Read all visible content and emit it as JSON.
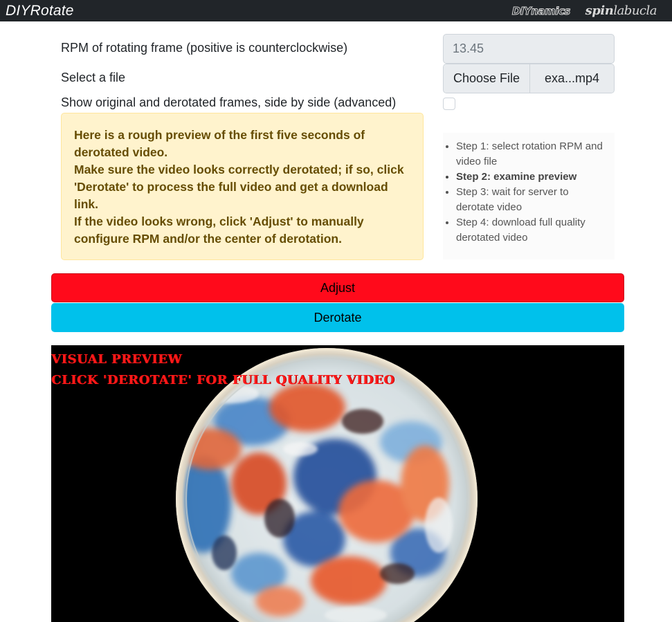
{
  "navbar": {
    "brand": "DIYRotate",
    "logo_left": "DIYnamics",
    "logo_right_spin": "spin",
    "logo_right_lab": "lab",
    "logo_right_ucla": "ucla"
  },
  "form": {
    "rpm_label": "RPM of rotating frame (positive is counterclockwise)",
    "rpm_value": "13.45",
    "file_label": "Select a file",
    "file_button": "Choose File",
    "file_name": "exa...mp4",
    "side_by_side_label": "Show original and derotated frames, side by side (advanced)",
    "side_by_side_checked": false
  },
  "alert": {
    "line1": "Here is a rough preview of the first five seconds of derotated video.",
    "line2": "Make sure the video looks correctly derotated; if so, click 'Derotate' to process the full video and get a download link.",
    "line3": "If the video looks wrong, click 'Adjust' to manually configure RPM and/or the center of derotation."
  },
  "steps": [
    {
      "label": "Step 1: select rotation RPM and video file",
      "active": false
    },
    {
      "label": "Step 2: examine preview",
      "active": true
    },
    {
      "label": "Step 3: wait for server to derotate video",
      "active": false
    },
    {
      "label": "Step 4: download full quality derotated video",
      "active": false
    }
  ],
  "buttons": {
    "adjust": "Adjust",
    "derotate": "Derotate"
  },
  "preview": {
    "overlay_line1": "VISUAL PREVIEW",
    "overlay_line2": "CLICK 'DEROTATE' FOR FULL QUALITY VIDEO"
  },
  "colors": {
    "navbar": "#212529",
    "adjust_button": "#ff0a1b",
    "derotate_button": "#00c1eb",
    "alert_bg": "#fff3cd",
    "alert_text": "#664d03",
    "overlay_text": "#ff1a1a"
  }
}
